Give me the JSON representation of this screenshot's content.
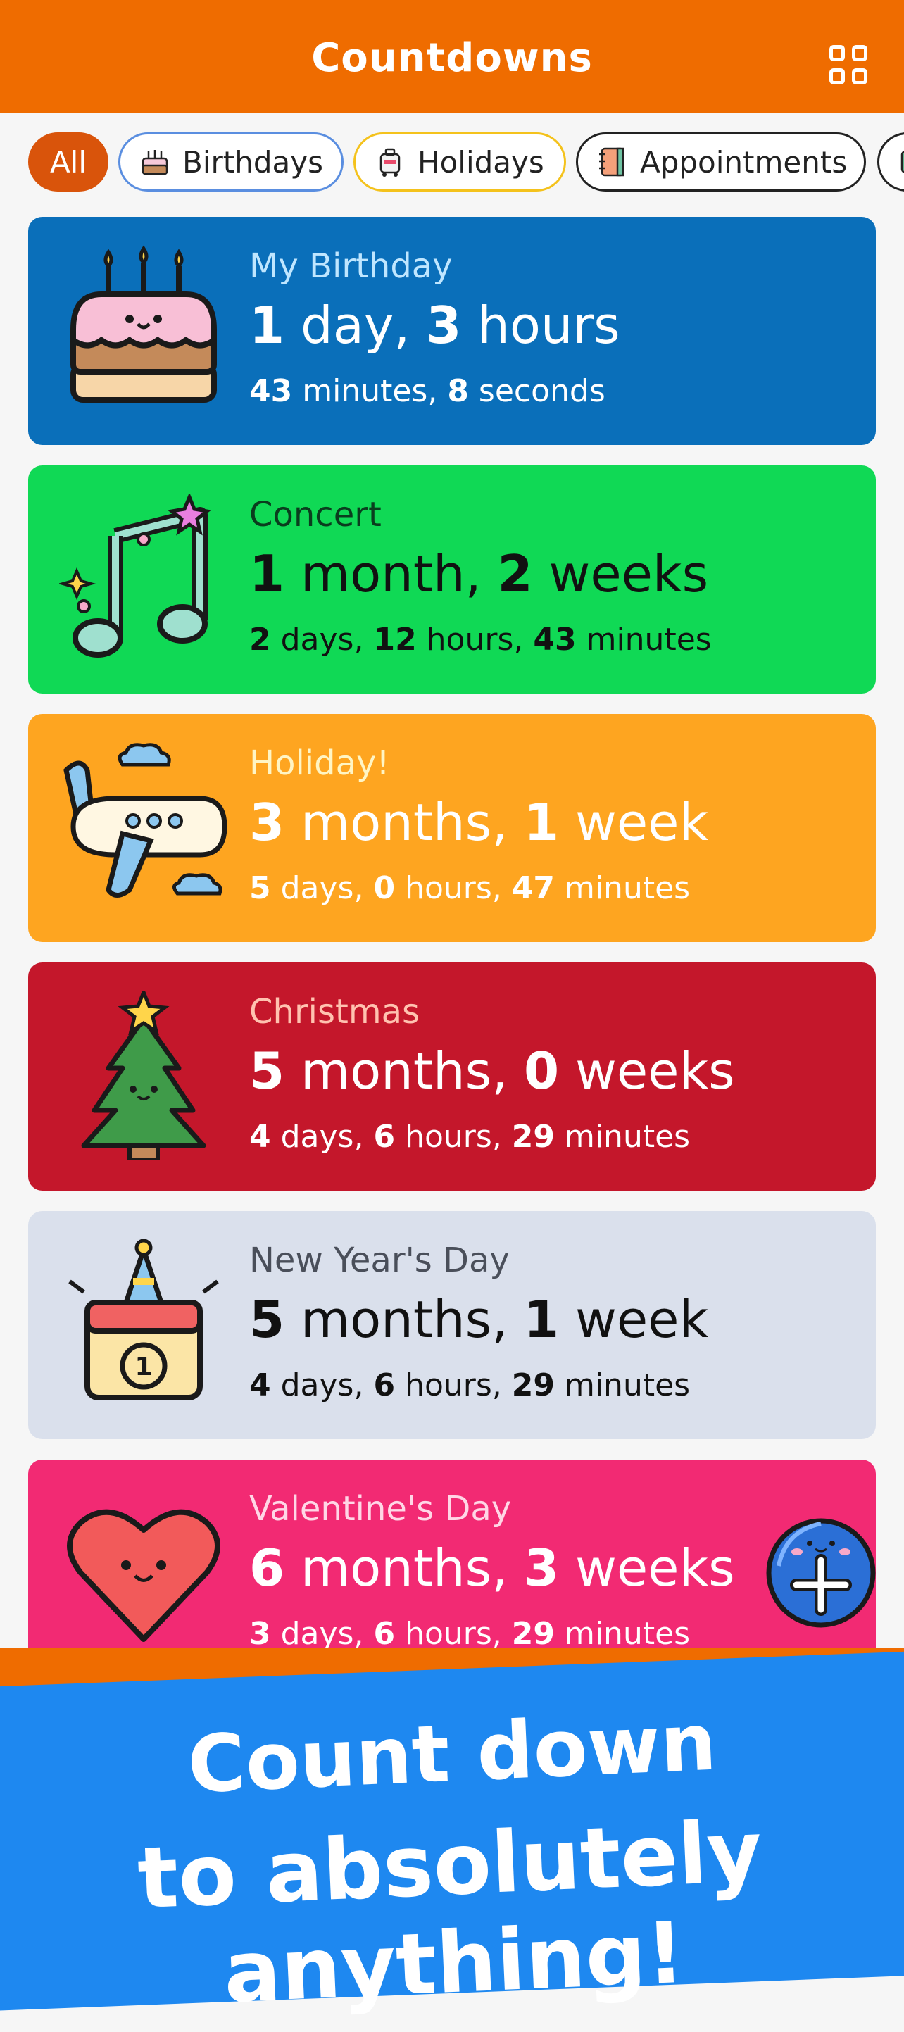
{
  "header": {
    "title": "Countdowns",
    "icon": "grid-icon"
  },
  "chips": [
    {
      "label": "All"
    },
    {
      "label": "Birthdays",
      "icon": "cake-icon"
    },
    {
      "label": "Holidays",
      "icon": "luggage-icon"
    },
    {
      "label": "Appointments",
      "icon": "notebook-icon"
    }
  ],
  "countdowns": [
    {
      "name": "My Birthday",
      "icon": "cake-icon",
      "color": "#0a6fba",
      "name_color": "#bfe6ff",
      "text_color": "#ffffff",
      "main": {
        "n1": "1",
        "u1": " day, ",
        "n2": "3",
        "u2": " hours"
      },
      "sub": {
        "n1": "43",
        "u1": " minutes, ",
        "n2": "8",
        "u2": " seconds",
        "n3": "",
        "u3": ""
      }
    },
    {
      "name": "Concert",
      "icon": "music-note-icon",
      "color": "#10d955",
      "name_color": "#0a3d1e",
      "text_color": "#111111",
      "main": {
        "n1": "1",
        "u1": " month, ",
        "n2": "2",
        "u2": " weeks"
      },
      "sub": {
        "n1": "2",
        "u1": " days, ",
        "n2": "12",
        "u2": " hours, ",
        "n3": "43",
        "u3": " minutes"
      }
    },
    {
      "name": "Holiday!",
      "icon": "airplane-icon",
      "color": "#fea520",
      "name_color": "#fff5c4",
      "text_color": "#ffffff",
      "main": {
        "n1": "3",
        "u1": " months, ",
        "n2": "1",
        "u2": " week"
      },
      "sub": {
        "n1": "5",
        "u1": " days, ",
        "n2": "0",
        "u2": " hours, ",
        "n3": "47",
        "u3": " minutes"
      }
    },
    {
      "name": "Christmas",
      "icon": "christmas-tree-icon",
      "color": "#c4172b",
      "name_color": "#ffc2b0",
      "text_color": "#ffffff",
      "main": {
        "n1": "5",
        "u1": " months, ",
        "n2": "0",
        "u2": " weeks"
      },
      "sub": {
        "n1": "4",
        "u1": " days, ",
        "n2": "6",
        "u2": " hours, ",
        "n3": "29",
        "u3": " minutes"
      }
    },
    {
      "name": "New Year's Day",
      "icon": "calendar-icon",
      "color": "#dae0ec",
      "name_color": "#4a4f5a",
      "text_color": "#111111",
      "main": {
        "n1": "5",
        "u1": " months, ",
        "n2": "1",
        "u2": " week"
      },
      "sub": {
        "n1": "4",
        "u1": " days, ",
        "n2": "6",
        "u2": " hours, ",
        "n3": "29",
        "u3": " minutes"
      }
    },
    {
      "name": "Valentine's Day",
      "icon": "heart-icon",
      "color": "#f22a73",
      "name_color": "#ffd6e6",
      "text_color": "#ffffff",
      "main": {
        "n1": "6",
        "u1": " months, ",
        "n2": "3",
        "u2": " weeks"
      },
      "sub": {
        "n1": "3",
        "u1": " days, ",
        "n2": "6",
        "u2": " hours, ",
        "n3": "29",
        "u3": " minutes"
      }
    }
  ],
  "fab": {
    "icon": "plus-icon"
  },
  "promo": {
    "line1": "Count down",
    "line2": "to absolutely anything!"
  }
}
